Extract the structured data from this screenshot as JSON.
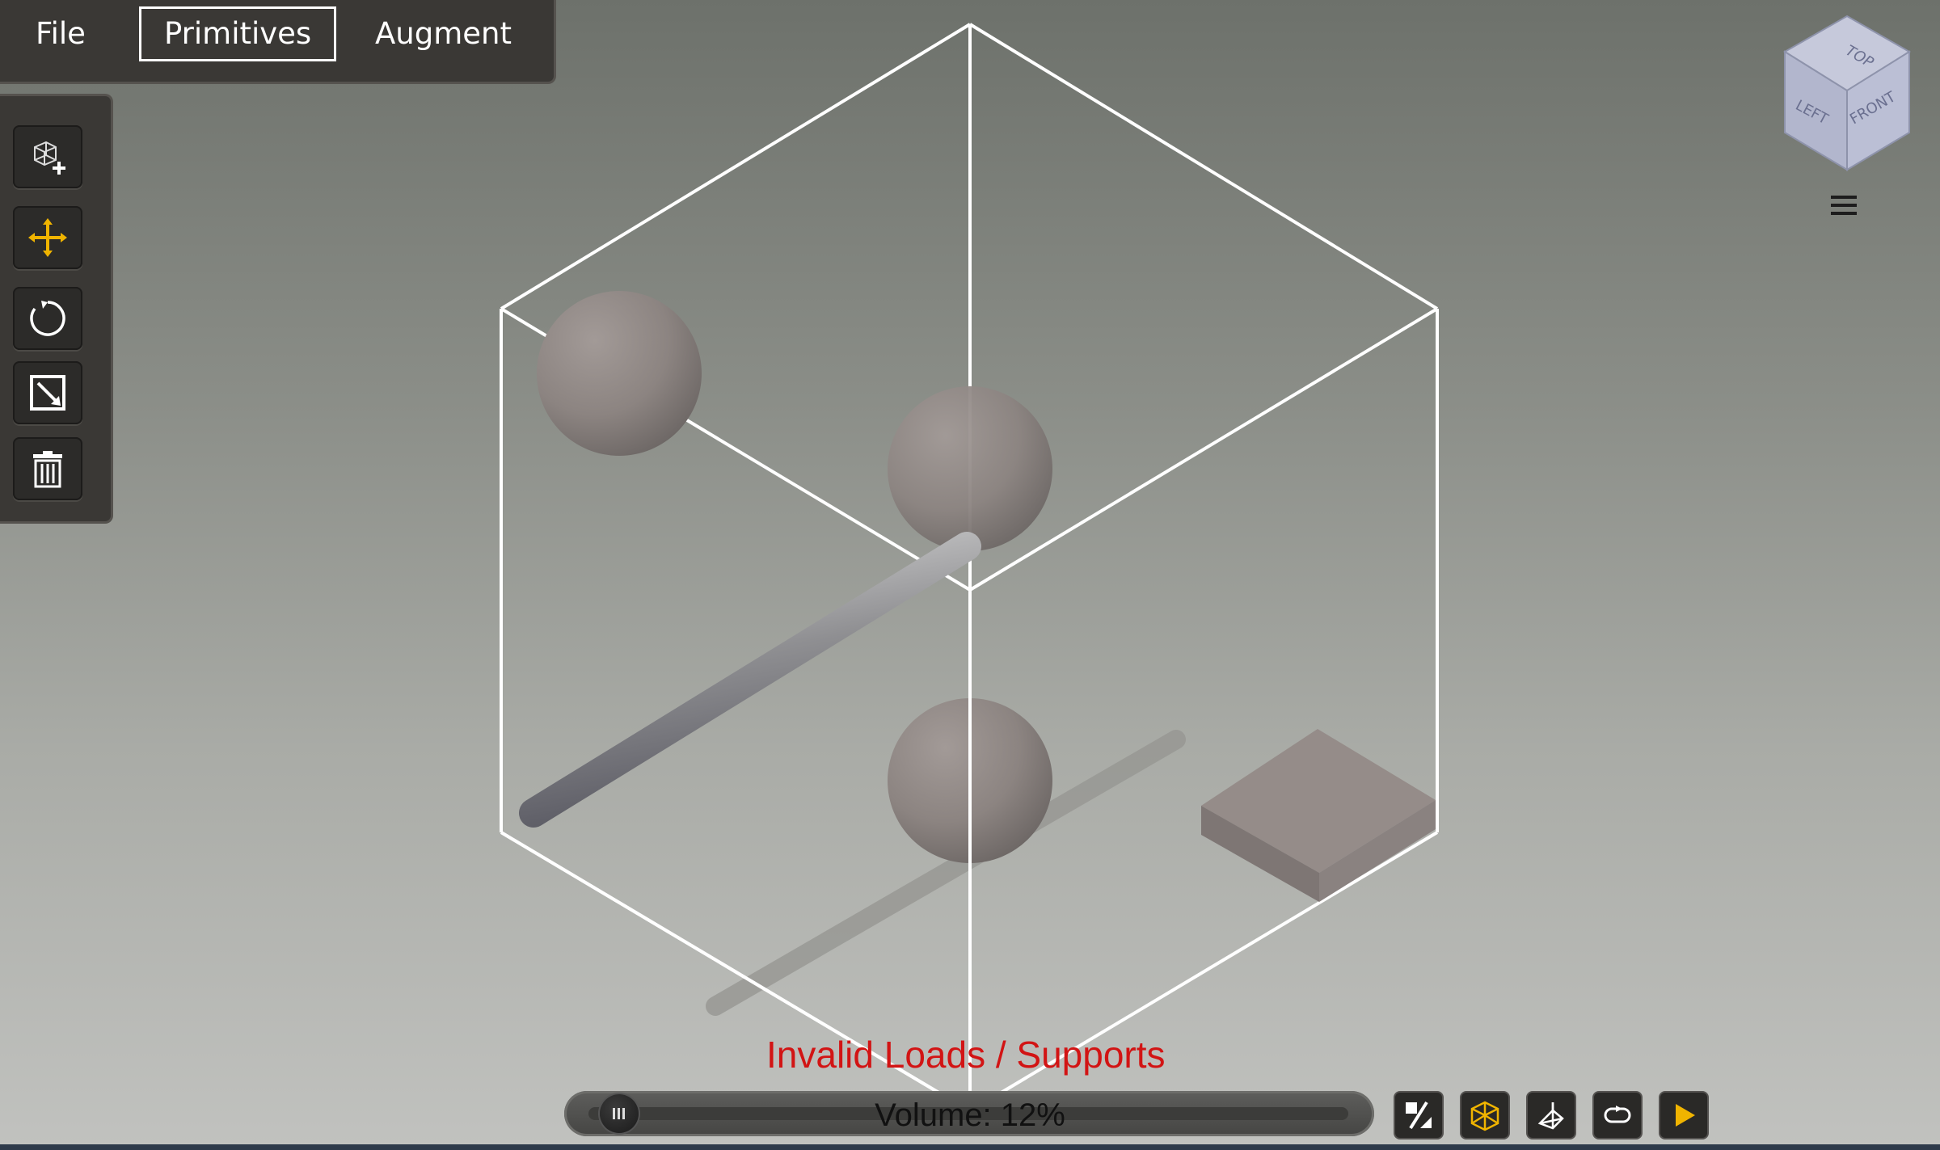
{
  "menu": {
    "items": [
      {
        "label": "File"
      },
      {
        "label": "Primitives"
      },
      {
        "label": "Augment"
      }
    ]
  },
  "tools": [
    {
      "icon": "add-primitive-icon"
    },
    {
      "icon": "move-icon",
      "active": true
    },
    {
      "icon": "rotate-icon"
    },
    {
      "icon": "scale-icon"
    },
    {
      "icon": "trash-icon"
    }
  ],
  "viewcube": {
    "faces": {
      "top": "TOP",
      "left": "LEFT",
      "front": "FRONT"
    }
  },
  "status": {
    "warning": "Invalid Loads / Supports"
  },
  "volume": {
    "label": "Volume: 12%",
    "value": 0.12
  },
  "bottom_tools": [
    {
      "icon": "load-support-icon"
    },
    {
      "icon": "wireframe-cube-icon",
      "active": true
    },
    {
      "icon": "perspective-icon"
    },
    {
      "icon": "loop-icon"
    },
    {
      "icon": "play-icon"
    }
  ],
  "colors": {
    "accent": "#f0b400",
    "warning": "#d21414",
    "panel": "#3a3835",
    "bounding_box": "#ffffff",
    "object": "#948c89"
  }
}
